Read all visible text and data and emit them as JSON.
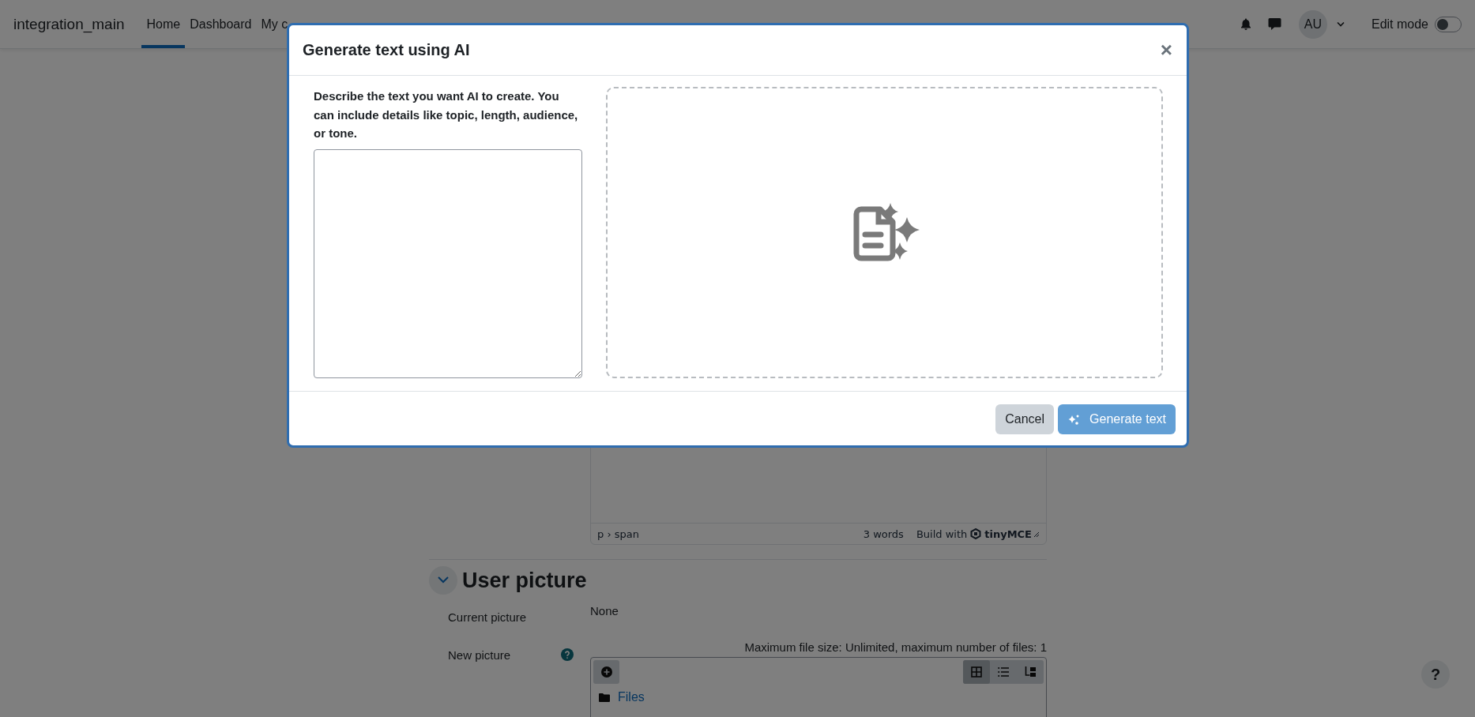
{
  "navbar": {
    "site_name": "integration_main",
    "nav_items": [
      {
        "label": "Home",
        "selected": true
      },
      {
        "label": "Dashboard",
        "selected": false
      },
      {
        "label": "My c",
        "selected": false
      }
    ],
    "avatar": "AU",
    "edit_mode": {
      "label": "Edit mode",
      "on": false
    }
  },
  "editor": {
    "path": "p › span",
    "word_count": "3 words",
    "branding": "Build with",
    "brand": "tinyMCE"
  },
  "user_picture": {
    "title": "User picture",
    "expanded": true,
    "current": {
      "label": "Current picture",
      "value": "None"
    },
    "new": {
      "label": "New picture",
      "max_size": "Maximum file size: Unlimited, maximum number of files: 1",
      "view_modes": [
        {
          "kind": "icons",
          "selected": true
        },
        {
          "kind": "list",
          "selected": false
        },
        {
          "kind": "tree",
          "selected": false
        }
      ],
      "folder": "Files"
    }
  },
  "help_button": "?",
  "modal": {
    "title": "Generate text using AI",
    "close": "×",
    "prompt_label": "Describe the text you want AI to create. You can include details like topic, length, audience, or tone.",
    "buttons": [
      {
        "label": "Cancel",
        "kind": "secondary",
        "disabled": false
      },
      {
        "label": "Generate text",
        "kind": "primary",
        "disabled": true
      }
    ]
  }
}
